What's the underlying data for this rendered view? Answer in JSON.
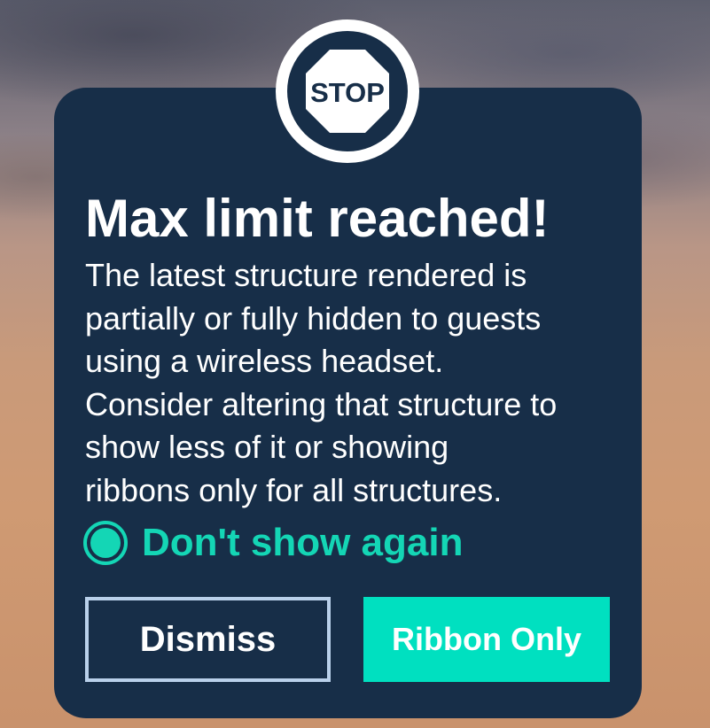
{
  "dialog": {
    "icon": "stop-sign-icon",
    "icon_text": "STOP",
    "title": "Max limit reached!",
    "message_lines": [
      "The latest structure rendered is",
      "partially or fully hidden to guests",
      "using a wireless headset.",
      "Consider altering that structure to",
      "show less of it or showing",
      "ribbons only for all structures."
    ],
    "dont_show_again": {
      "label": "Don't show again",
      "checked": true
    },
    "buttons": {
      "dismiss_label": "Dismiss",
      "ribbon_only_label": "Ribbon Only"
    }
  },
  "colors": {
    "panel": "#172e48",
    "accent": "#14d6b5",
    "primary_button": "#00e0c0",
    "outline_button": "#b9d0ea",
    "text": "#ffffff"
  }
}
